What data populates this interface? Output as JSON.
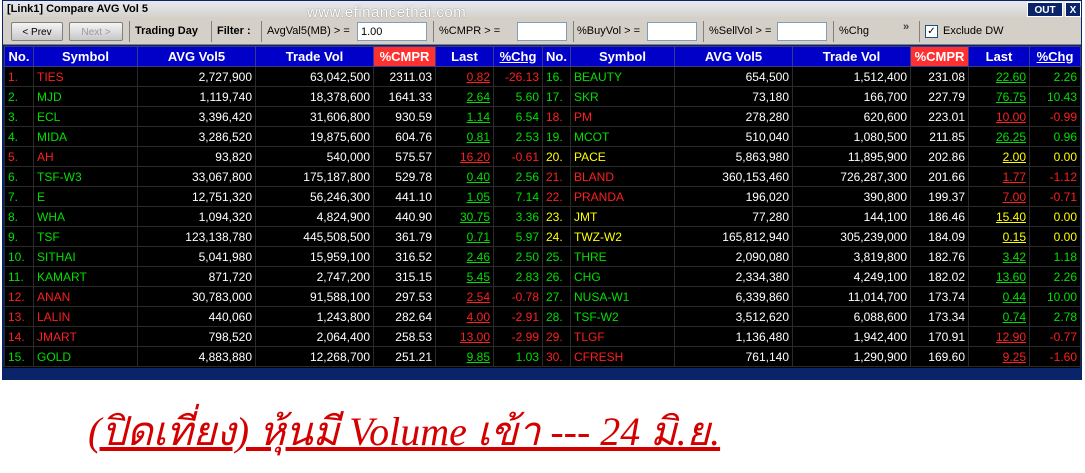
{
  "window": {
    "title": "[Link1] Compare AVG Vol 5",
    "watermark": "www.efinancethai.com",
    "out_label": "OUT",
    "close_label": "X"
  },
  "toolbar": {
    "prev_label": "< Prev",
    "next_label": "Next >",
    "trading_day": "Trading Day",
    "filter_label": "Filter :",
    "avgvol_label": "AvgVal5(MB) > =",
    "avgvol_value": "1.00",
    "cmpr_label": "%CMPR > =",
    "cmpr_value": "",
    "buyvol_label": "%BuyVol > =",
    "buyvol_value": "",
    "sellvol_label": "%SellVol > =",
    "sellvol_value": "",
    "chg_label": "%Chg",
    "more_label": "»",
    "exclude_dw_label": "Exclude DW",
    "exclude_dw_checked": "✓"
  },
  "headers": [
    "No.",
    "Symbol",
    "AVG Vol5",
    "Trade Vol",
    "%CMPR",
    "Last",
    "%Chg"
  ],
  "left_rows": [
    {
      "no": "1.",
      "symbol": "TIES",
      "avg": "2,727,900",
      "trade": "63,042,500",
      "cmpr": "2311.03",
      "last": "0.82",
      "chg": "-26.13",
      "dir": "dn"
    },
    {
      "no": "2.",
      "symbol": "MJD",
      "avg": "1,119,740",
      "trade": "18,378,600",
      "cmpr": "1641.33",
      "last": "2.64",
      "chg": "5.60",
      "dir": "up"
    },
    {
      "no": "3.",
      "symbol": "ECL",
      "avg": "3,396,420",
      "trade": "31,606,800",
      "cmpr": "930.59",
      "last": "1.14",
      "chg": "6.54",
      "dir": "up"
    },
    {
      "no": "4.",
      "symbol": "MIDA",
      "avg": "3,286,520",
      "trade": "19,875,600",
      "cmpr": "604.76",
      "last": "0.81",
      "chg": "2.53",
      "dir": "up"
    },
    {
      "no": "5.",
      "symbol": "AH",
      "avg": "93,820",
      "trade": "540,000",
      "cmpr": "575.57",
      "last": "16.20",
      "chg": "-0.61",
      "dir": "dn"
    },
    {
      "no": "6.",
      "symbol": "TSF-W3",
      "avg": "33,067,800",
      "trade": "175,187,800",
      "cmpr": "529.78",
      "last": "0.40",
      "chg": "2.56",
      "dir": "up"
    },
    {
      "no": "7.",
      "symbol": "E",
      "avg": "12,751,320",
      "trade": "56,246,300",
      "cmpr": "441.10",
      "last": "1.05",
      "chg": "7.14",
      "dir": "up"
    },
    {
      "no": "8.",
      "symbol": "WHA",
      "avg": "1,094,320",
      "trade": "4,824,900",
      "cmpr": "440.90",
      "last": "30.75",
      "chg": "3.36",
      "dir": "up"
    },
    {
      "no": "9.",
      "symbol": "TSF",
      "avg": "123,138,780",
      "trade": "445,508,500",
      "cmpr": "361.79",
      "last": "0.71",
      "chg": "5.97",
      "dir": "up"
    },
    {
      "no": "10.",
      "symbol": "SITHAI",
      "avg": "5,041,980",
      "trade": "15,959,100",
      "cmpr": "316.52",
      "last": "2.46",
      "chg": "2.50",
      "dir": "up"
    },
    {
      "no": "11.",
      "symbol": "KAMART",
      "avg": "871,720",
      "trade": "2,747,200",
      "cmpr": "315.15",
      "last": "5.45",
      "chg": "2.83",
      "dir": "up"
    },
    {
      "no": "12.",
      "symbol": "ANAN",
      "avg": "30,783,000",
      "trade": "91,588,100",
      "cmpr": "297.53",
      "last": "2.54",
      "chg": "-0.78",
      "dir": "dn"
    },
    {
      "no": "13.",
      "symbol": "LALIN",
      "avg": "440,060",
      "trade": "1,243,800",
      "cmpr": "282.64",
      "last": "4.00",
      "chg": "-2.91",
      "dir": "dn"
    },
    {
      "no": "14.",
      "symbol": "JMART",
      "avg": "798,520",
      "trade": "2,064,400",
      "cmpr": "258.53",
      "last": "13.00",
      "chg": "-2.99",
      "dir": "dn"
    },
    {
      "no": "15.",
      "symbol": "GOLD",
      "avg": "4,883,880",
      "trade": "12,268,700",
      "cmpr": "251.21",
      "last": "9.85",
      "chg": "1.03",
      "dir": "up"
    }
  ],
  "right_rows": [
    {
      "no": "16.",
      "symbol": "BEAUTY",
      "avg": "654,500",
      "trade": "1,512,400",
      "cmpr": "231.08",
      "last": "22.60",
      "chg": "2.26",
      "dir": "up"
    },
    {
      "no": "17.",
      "symbol": "SKR",
      "avg": "73,180",
      "trade": "166,700",
      "cmpr": "227.79",
      "last": "76.75",
      "chg": "10.43",
      "dir": "up"
    },
    {
      "no": "18.",
      "symbol": "PM",
      "avg": "278,280",
      "trade": "620,600",
      "cmpr": "223.01",
      "last": "10.00",
      "chg": "-0.99",
      "dir": "dn"
    },
    {
      "no": "19.",
      "symbol": "MCOT",
      "avg": "510,040",
      "trade": "1,080,500",
      "cmpr": "211.85",
      "last": "26.25",
      "chg": "0.96",
      "dir": "up"
    },
    {
      "no": "20.",
      "symbol": "PACE",
      "avg": "5,863,980",
      "trade": "11,895,900",
      "cmpr": "202.86",
      "last": "2.00",
      "chg": "0.00",
      "dir": "nc"
    },
    {
      "no": "21.",
      "symbol": "BLAND",
      "avg": "360,153,460",
      "trade": "726,287,300",
      "cmpr": "201.66",
      "last": "1.77",
      "chg": "-1.12",
      "dir": "dn"
    },
    {
      "no": "22.",
      "symbol": "PRANDA",
      "avg": "196,020",
      "trade": "390,800",
      "cmpr": "199.37",
      "last": "7.00",
      "chg": "-0.71",
      "dir": "dn"
    },
    {
      "no": "23.",
      "symbol": "JMT",
      "avg": "77,280",
      "trade": "144,100",
      "cmpr": "186.46",
      "last": "15.40",
      "chg": "0.00",
      "dir": "nc"
    },
    {
      "no": "24.",
      "symbol": "TWZ-W2",
      "avg": "165,812,940",
      "trade": "305,239,000",
      "cmpr": "184.09",
      "last": "0.15",
      "chg": "0.00",
      "dir": "nc"
    },
    {
      "no": "25.",
      "symbol": "THRE",
      "avg": "2,090,080",
      "trade": "3,819,800",
      "cmpr": "182.76",
      "last": "3.42",
      "chg": "1.18",
      "dir": "up"
    },
    {
      "no": "26.",
      "symbol": "CHG",
      "avg": "2,334,380",
      "trade": "4,249,100",
      "cmpr": "182.02",
      "last": "13.60",
      "chg": "2.26",
      "dir": "up"
    },
    {
      "no": "27.",
      "symbol": "NUSA-W1",
      "avg": "6,339,860",
      "trade": "11,014,700",
      "cmpr": "173.74",
      "last": "0.44",
      "chg": "10.00",
      "dir": "up"
    },
    {
      "no": "28.",
      "symbol": "TSF-W2",
      "avg": "3,512,620",
      "trade": "6,088,600",
      "cmpr": "173.34",
      "last": "0.74",
      "chg": "2.78",
      "dir": "up"
    },
    {
      "no": "29.",
      "symbol": "TLGF",
      "avg": "1,136,480",
      "trade": "1,942,400",
      "cmpr": "170.91",
      "last": "12.90",
      "chg": "-0.77",
      "dir": "dn"
    },
    {
      "no": "30.",
      "symbol": "CFRESH",
      "avg": "761,140",
      "trade": "1,290,900",
      "cmpr": "169.60",
      "last": "9.25",
      "chg": "-1.60",
      "dir": "dn"
    }
  ],
  "caption": "(ปิดเที่ยง) หุ้นมี Volume เข้า --- 24 มิ.ย."
}
